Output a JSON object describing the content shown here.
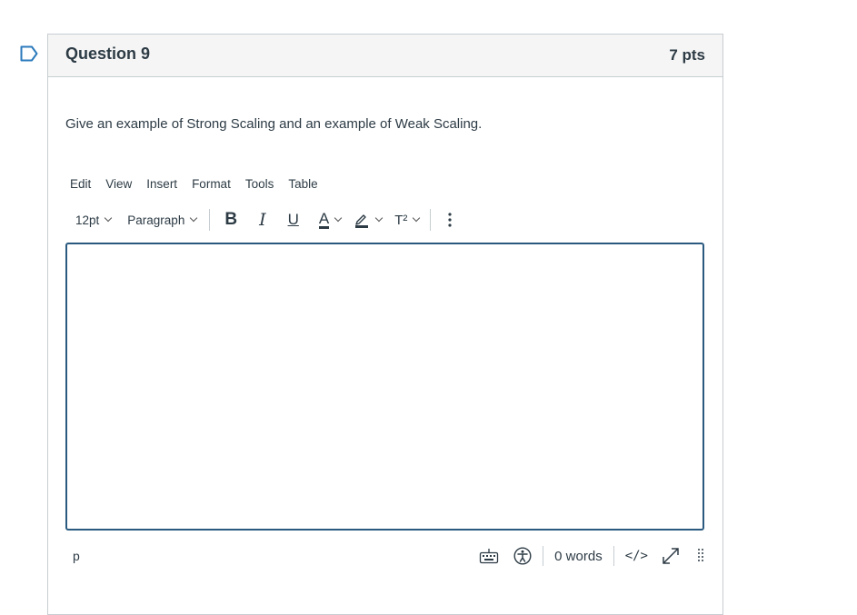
{
  "question": {
    "title": "Question 9",
    "points": "7 pts",
    "text": "Give an example of Strong Scaling and an example of Weak Scaling."
  },
  "menubar": {
    "items": [
      "Edit",
      "View",
      "Insert",
      "Format",
      "Tools",
      "Table"
    ]
  },
  "toolbar": {
    "font_size": "12pt",
    "block_format": "Paragraph",
    "bold": "B",
    "italic": "I",
    "underline": "U",
    "text_color": "A",
    "superscript": "T²"
  },
  "statusbar": {
    "path": "p",
    "word_count": "0 words",
    "html_toggle": "</>"
  },
  "colors": {
    "border": "#c7cdd1",
    "header_bg": "#f5f5f5",
    "editor_focus": "#2b5a80",
    "text": "#2d3b45"
  },
  "icons": [
    "flag-icon",
    "keyboard-icon",
    "accessibility-icon",
    "fullscreen-icon",
    "resize-handle-icon",
    "more-options-icon",
    "highlight-icon"
  ]
}
